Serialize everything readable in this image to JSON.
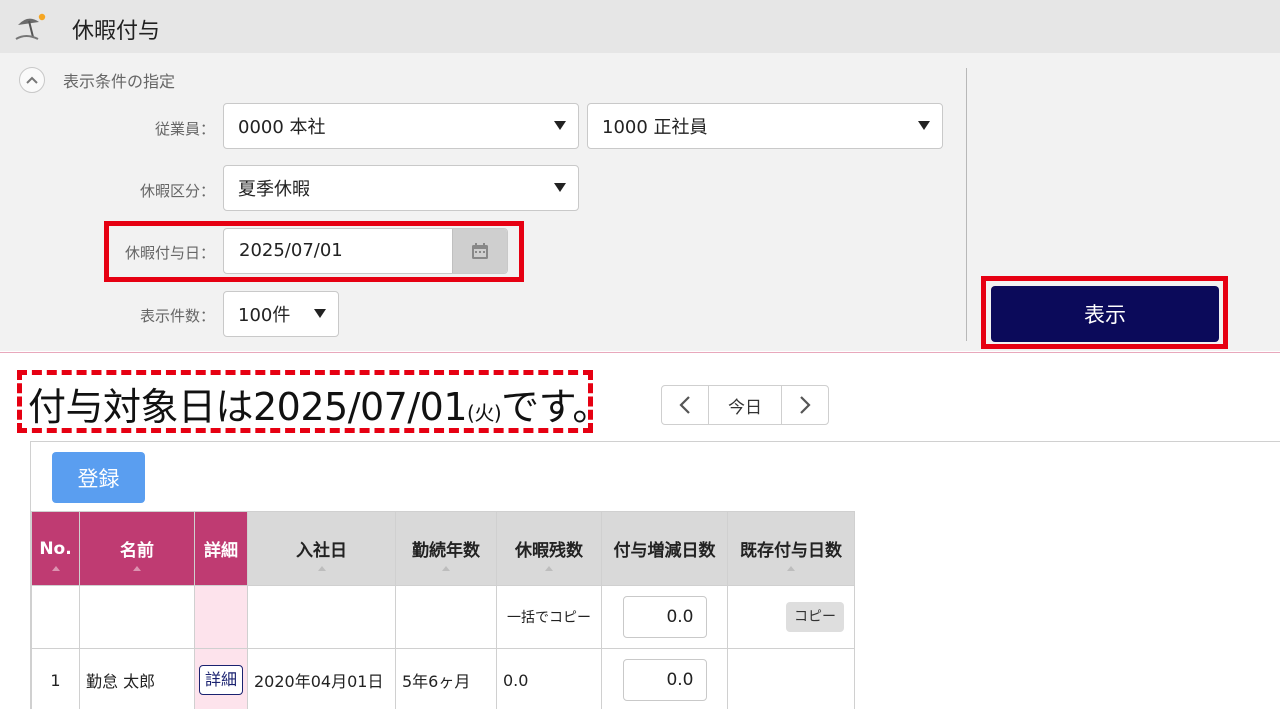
{
  "app": {
    "title": "休暇付与"
  },
  "conditions": {
    "section_title": "表示条件の指定",
    "employee": {
      "label": "従業員：",
      "org_value": "0000 本社",
      "type_value": "1000 正社員"
    },
    "leave_type": {
      "label": "休暇区分：",
      "value": "夏季休暇"
    },
    "grant_date": {
      "label": "休暇付与日：",
      "value": "2025/07/01"
    },
    "count": {
      "label": "表示件数：",
      "value": "100件"
    },
    "show_button": "表示"
  },
  "headline": {
    "prefix": "付与対象日は2025/07/01",
    "weekday": "(火)",
    "suffix": "です。"
  },
  "nav": {
    "prev": "‹",
    "today": "今日",
    "next": "›"
  },
  "register_button": "登録",
  "table": {
    "headers": {
      "no": "No.",
      "name": "名前",
      "detail": "詳細",
      "hire_date": "入社日",
      "years": "勤続年数",
      "remaining": "休暇残数",
      "grant_delta": "付与増減日数",
      "existing": "既存付与日数"
    },
    "bulk_row": {
      "remaining": "一括でコピー",
      "grant_delta": "0.0",
      "existing_button": "コピー"
    },
    "rows": [
      {
        "no": "1",
        "name": "勤怠 太郎",
        "detail_button": "詳細",
        "hire_date": "2020年04月01日",
        "years": "5年6ヶ月",
        "remaining": "0.0",
        "grant_delta": "0.0",
        "existing": ""
      }
    ]
  },
  "colors": {
    "accent_navy": "#0b0a5a",
    "header_pink": "#bf3b72",
    "register_blue": "#5a9ef0",
    "highlight_red": "#e60012"
  }
}
